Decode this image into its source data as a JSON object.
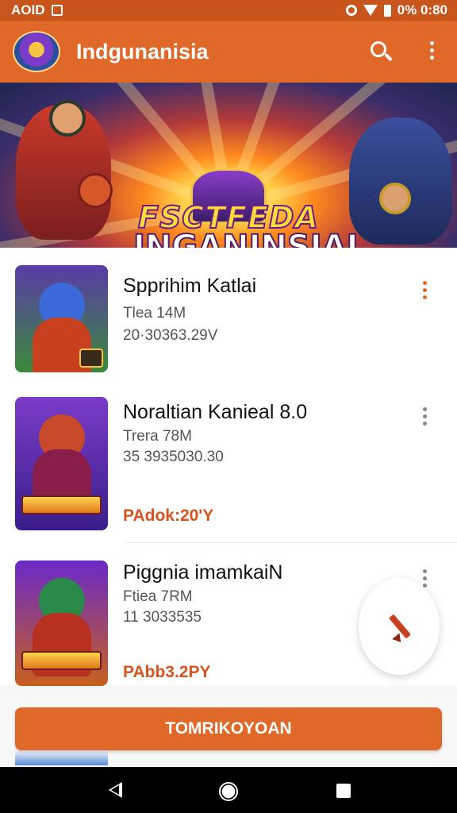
{
  "status_bar": {
    "left_text": "AOID",
    "right_text": "0% 0:80"
  },
  "app_bar": {
    "title": "Indgunanisia",
    "logo_icon": "game-logo-icon",
    "search_icon": "search-icon",
    "menu_icon": "more-vert-icon"
  },
  "banner": {
    "line1": "FSCTFEDA",
    "line2": "INGANINSIAI",
    "slides": 4,
    "active_slide": 1
  },
  "games": [
    {
      "title": "Spprihim Katlai",
      "size": "Tlea 14M",
      "details": "20·30363.29V",
      "price": ""
    },
    {
      "title": "Noraltian Kanieal 8.0",
      "size": "Trera 78M",
      "details": "35 3935030.30",
      "price": "PAdok:20'Y"
    },
    {
      "title": "Piggnia imamkaiN",
      "size": "Ftiea 7RM",
      "details": "11 3033535",
      "price": "PAbb3.2PY"
    }
  ],
  "cta": {
    "label": "TOMRIKOYOAN"
  },
  "fab": {
    "icon": "pencil-icon"
  },
  "nav": {
    "back_icon": "back-icon",
    "home_icon": "home-icon",
    "recent_icon": "recent-apps-icon"
  },
  "colors": {
    "primary": "#e0692a",
    "status_bar": "#c8551c",
    "price": "#d9531e"
  }
}
